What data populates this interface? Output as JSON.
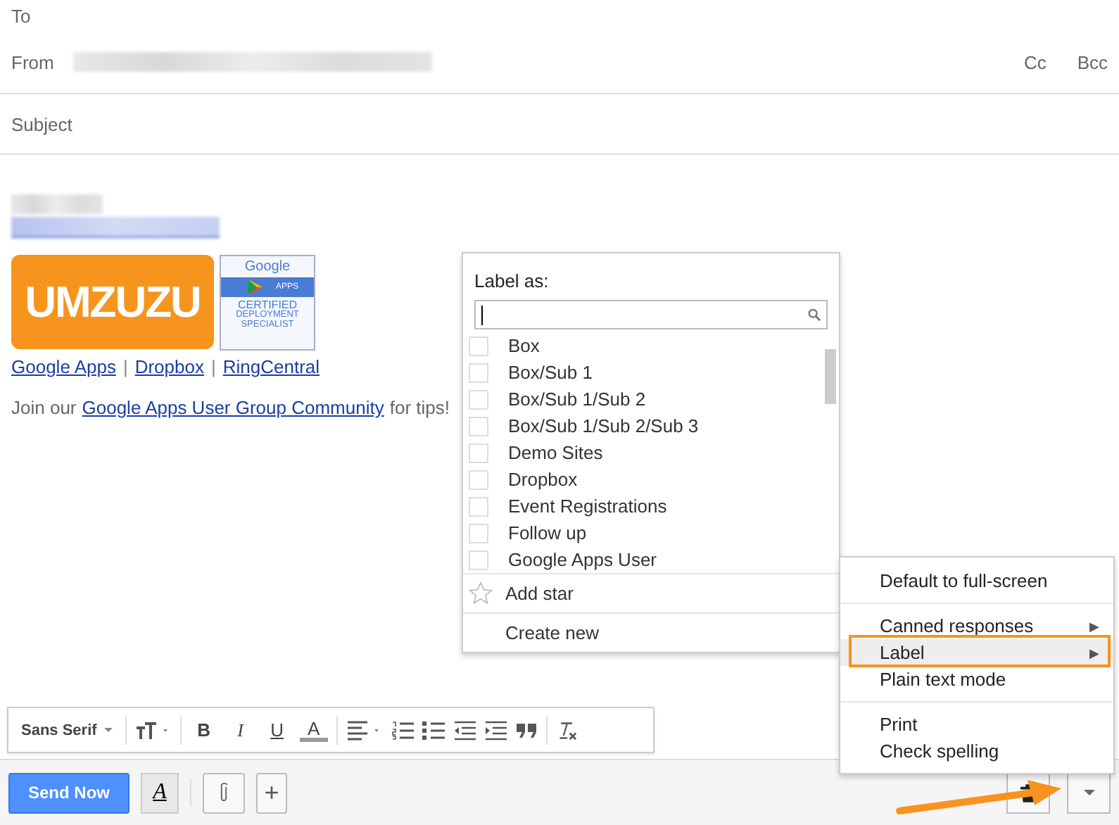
{
  "header": {
    "to_label": "To",
    "from_label": "From",
    "cc": "Cc",
    "bcc": "Bcc",
    "subject_placeholder": "Subject"
  },
  "signature": {
    "logo_text": "UMZUZU",
    "badge": {
      "brand": "Google",
      "product": "APPS",
      "line1": "CERTIFIED",
      "line2": "DEPLOYMENT",
      "line3": "SPECIALIST"
    },
    "links": [
      "Google Apps",
      "Dropbox",
      "RingCentral "
    ],
    "separator": "|",
    "join_before": "Join our",
    "join_link": "Google Apps User Group Community",
    "join_after": "for tips!"
  },
  "label_menu": {
    "title": "Label as:",
    "labels": [
      {
        "name": "Box",
        "checked": false
      },
      {
        "name": "Box/Sub 1",
        "checked": false
      },
      {
        "name": "Box/Sub 1/Sub 2",
        "checked": false
      },
      {
        "name": "Box/Sub 1/Sub 2/Sub 3",
        "checked": false
      },
      {
        "name": "Demo Sites",
        "checked": false
      },
      {
        "name": "Dropbox",
        "checked": false
      },
      {
        "name": "Event Registrations",
        "checked": false
      },
      {
        "name": "Follow up",
        "checked": false
      },
      {
        "name": "Google Apps User",
        "checked": false
      }
    ],
    "add_star": "Add star",
    "create_new": "Create new"
  },
  "more_menu": {
    "groups": [
      [
        {
          "label": "Default to full-screen",
          "submenu": false,
          "selected": false
        }
      ],
      [
        {
          "label": "Canned responses",
          "submenu": true,
          "selected": false
        },
        {
          "label": "Label",
          "submenu": true,
          "selected": true
        },
        {
          "label": "Plain text mode",
          "submenu": false,
          "selected": false
        }
      ],
      [
        {
          "label": "Print",
          "submenu": false,
          "selected": false
        },
        {
          "label": "Check spelling",
          "submenu": false,
          "selected": false
        }
      ]
    ],
    "submenu_glyph": "▶"
  },
  "format_toolbar": [
    {
      "kind": "font",
      "label": "Sans Serif"
    },
    {
      "kind": "size"
    },
    {
      "kind": "bold",
      "label": "B"
    },
    {
      "kind": "italic",
      "label": "I"
    },
    {
      "kind": "underline",
      "label": "U"
    },
    {
      "kind": "color",
      "label": "A"
    },
    {
      "kind": "align"
    },
    {
      "kind": "numbered"
    },
    {
      "kind": "bulleted"
    },
    {
      "kind": "outdent"
    },
    {
      "kind": "indent"
    },
    {
      "kind": "quote"
    },
    {
      "kind": "clear"
    }
  ],
  "bottom_bar": {
    "send": "Send Now",
    "format_glyph": "A",
    "add_glyph": "+"
  }
}
